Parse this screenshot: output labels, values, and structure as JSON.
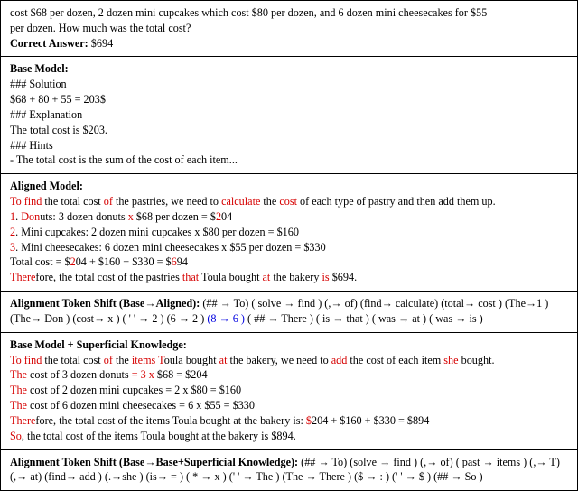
{
  "problem": {
    "line1": "cost $68 per dozen, 2 dozen mini cupcakes which cost $80 per dozen, and 6 dozen mini cheesecakes for $55",
    "line2_a": "per dozen. How much was the total cost?",
    "correct_label": "Correct Answer:",
    "correct_value": " $694"
  },
  "base": {
    "title": "Base Model:",
    "s1": "### Solution",
    "s2": "$68 + 80 + 55 = 203$",
    "s3": "### Explanation",
    "s4": "The total cost is $203.",
    "s5": "### Hints",
    "s6": "- The total cost is the sum of the cost of each item..."
  },
  "aligned": {
    "title": "Aligned Model:",
    "l1_a": "To find",
    "l1_b": " the total cost ",
    "l1_c": "of",
    "l1_d": " the pastries, we need to ",
    "l1_e": "calculate",
    "l1_f": " the ",
    "l1_g": "cost",
    "l1_h": " of each type of pastry and then add them up.",
    "l2_a": "1",
    "l2_b": ". ",
    "l2_c": "Don",
    "l2_d": "uts: 3 dozen donuts ",
    "l2_e": "x",
    "l2_f": " $68 per dozen = $",
    "l2_g": "2",
    "l2_h": "04",
    "l3_a": "2",
    "l3_b": ". Mini cupcakes: 2 dozen mini cupcakes x $80 per dozen = $160",
    "l4_a": "3",
    "l4_b": ". Mini cheesecakes: 6 dozen mini cheesecakes x $55 per dozen = $330",
    "l5_a": "Total cost = $",
    "l5_b": "2",
    "l5_c": "04 + $160 + $330 = $",
    "l5_d": "6",
    "l5_e": "94",
    "l6_a": "There",
    "l6_b": "fore, the total cost of the pastries ",
    "l6_c": "that",
    "l6_d": " Toula bought ",
    "l6_e": "at",
    "l6_f": " the bakery ",
    "l6_g": "is",
    "l6_h": " $694."
  },
  "shift_aligned": {
    "title": "Alignment Token Shift (Base→Aligned): ",
    "seq_a": "(## → To) ( solve → find ) (,→ of) (find→ calculate) (total→ cost ) (The→1 ) (The→ Don ) (cost→ x ) ( ' ' → 2 ) (6 → 2 ) ",
    "seq_blue": "(8 → 6 )",
    "seq_b": " ( ## → There ) ( is → that ) ( was → at ) ( was → is )"
  },
  "superficial": {
    "title": "Base Model + Superficial Knowledge:",
    "l1_a": "To find",
    "l1_b": " the total cost ",
    "l1_c": "of",
    "l1_d": " the ",
    "l1_e": "items T",
    "l1_f": "oula bought ",
    "l1_g": "at",
    "l1_h": " the bakery, we need to ",
    "l1_i": "add",
    "l1_j": " the cost of each item ",
    "l1_k": "she",
    "l1_l": " bought.",
    "l2_a": "The",
    "l2_b": " cost of 3 dozen donuts ",
    "l2_c": "= 3 x",
    "l2_d": " $68 = $204",
    "l3_a": "The",
    "l3_b": " cost of 2 dozen mini cupcakes = 2 x $80 = $160",
    "l4_a": "The",
    "l4_b": " cost of 6 dozen mini cheesecakes = 6 x $55 = $330",
    "l5_a": "There",
    "l5_b": "fore, the total cost of the items Toula bought at the bakery is:  ",
    "l5_c": "$",
    "l5_d": "204 + $160 + $330 = $894",
    "l6_a": "So",
    "l6_b": ", the total cost of the items Toula bought at the bakery is $894."
  },
  "shift_superficial": {
    "title": "Alignment Token Shift (Base→Base+Superficial Knowledge): ",
    "seq": "(## → To) (solve → find ) (,→ of) ( past → items ) (,→ T) (,→ at) (find→ add ) (.→she ) (is→ = ) ( * → x ) (' ' → The ) (The → There ) ($ → : ) (' ' → $ ) (## → So )"
  }
}
